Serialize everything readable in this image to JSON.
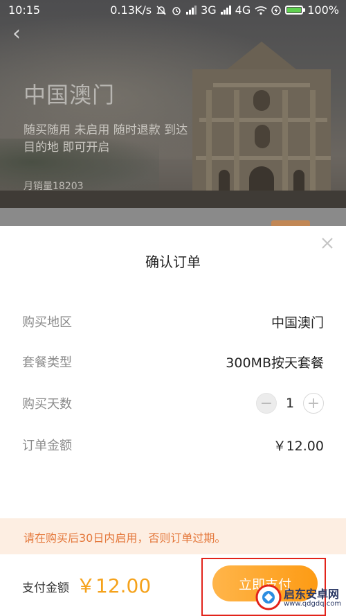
{
  "status_bar": {
    "time": "10:15",
    "net_speed": "0.13K/s",
    "net1": "3G",
    "net2": "4G",
    "battery": "100%"
  },
  "hero": {
    "title": "中国澳门",
    "description": "随买随用 未启用 随时退款 到达目的地 即可开启",
    "sales": "月销量18203"
  },
  "modal": {
    "title": "确认订单",
    "rows": [
      {
        "label": "购买地区",
        "value": "中国澳门"
      },
      {
        "label": "套餐类型",
        "value": "300MB按天套餐"
      },
      {
        "label": "购买天数",
        "value": "1"
      },
      {
        "label": "订单金额",
        "value": "￥12.00"
      }
    ],
    "stepper": {
      "minus": "−",
      "plus": "+"
    },
    "notice": "请在购买后30日内启用，否则订单过期。"
  },
  "footer": {
    "pay_label": "支付金额",
    "pay_amount": "￥12.00",
    "pay_button": "立即支付"
  },
  "watermark": {
    "name": "启东安卓网",
    "url": "www.qdgdq.com"
  },
  "colors": {
    "accent": "#fd9b14",
    "notice_bg": "#fdeee2",
    "notice_text": "#e4773a",
    "battery": "#5fd04f",
    "highlight": "#e2231a"
  }
}
